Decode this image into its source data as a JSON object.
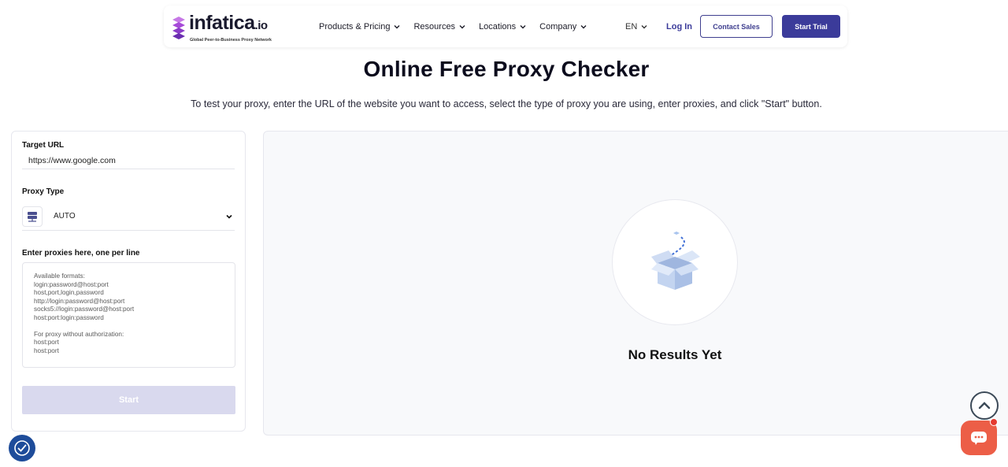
{
  "brand": {
    "name": "infatica",
    "suffix": ".io",
    "tagline": "Global Peer-to-Business Proxy Network"
  },
  "nav": {
    "items": [
      {
        "label": "Products & Pricing"
      },
      {
        "label": "Resources"
      },
      {
        "label": "Locations"
      },
      {
        "label": "Company"
      }
    ],
    "lang": "EN",
    "login": "Log In",
    "contact": "Contact Sales",
    "trial": "Start Trial"
  },
  "header": {
    "title": "Online Free Proxy Checker",
    "description": "To test your proxy, enter the URL of the website you want to access, select the type of proxy you are using, enter proxies, and click \"Start\" button."
  },
  "form": {
    "target_label": "Target URL",
    "target_value": "https://www.google.com",
    "proxy_type_label": "Proxy Type",
    "proxy_type_value": "AUTO",
    "proxies_label": "Enter proxies here, one per line",
    "proxies_placeholder": "Available formats:\nlogin:password@host:port\nhost,port,login,password\nhttp://login:password@host:port\nsocks5://login:password@host:port\nhost:port:login:password\n\nFor proxy without authorization:\nhost:port\nhost:port",
    "start_label": "Start"
  },
  "results": {
    "empty_label": "No Results Yet"
  },
  "colors": {
    "brand": "#3b3b9a",
    "start_disabled": "#d9d9ee",
    "chat": "#ec5e47",
    "consent": "#1e4c9a"
  }
}
